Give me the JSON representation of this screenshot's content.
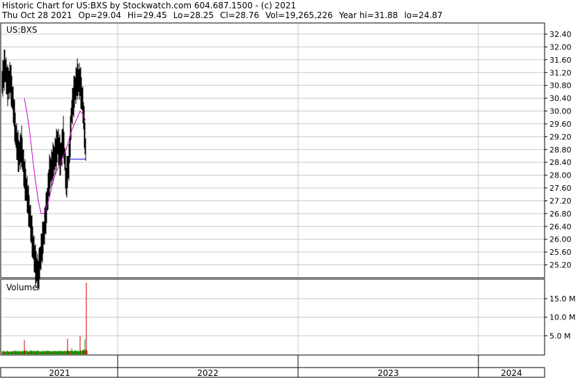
{
  "header": {
    "line1": "Historic Chart for US:BXS by Stockwatch.com 604.687.1500 - (c) 2021",
    "date": "Thu Oct 28 2021",
    "open": "Op=29.04",
    "high": "Hi=29.45",
    "low": "Lo=28.25",
    "close": "Cl=28.76",
    "volume": "Vol=19,265,226",
    "year_high": "Year hi=31.88",
    "year_low": "lo=24.87"
  },
  "colors": {
    "price": "#000000",
    "moving_average": "#cc00cc",
    "short_average": "#0000cc",
    "volume_up": "#00aa00",
    "volume_down": "#cc0000",
    "grid": "#c8c8c8"
  },
  "chart_data": [
    {
      "type": "line",
      "title": "US:BXS",
      "ylim": [
        24.8,
        32.8
      ],
      "yticks": [
        "32.40",
        "32.00",
        "31.60",
        "31.20",
        "30.80",
        "30.40",
        "30.00",
        "29.60",
        "29.20",
        "28.80",
        "28.40",
        "28.00",
        "27.60",
        "27.20",
        "26.80",
        "26.40",
        "26.00",
        "25.60",
        "25.20"
      ],
      "grid": true,
      "x_labels": [
        "2021",
        "2022",
        "2023",
        "2024"
      ],
      "x": [
        0,
        4,
        8,
        12,
        16,
        20,
        24,
        28,
        32,
        36,
        40,
        44,
        48,
        52,
        56,
        60,
        64,
        68,
        72,
        76,
        80,
        84,
        88,
        92,
        96,
        100,
        104,
        108,
        112,
        116,
        120
      ],
      "series": [
        {
          "style": "hl-bars",
          "values": [
            30.9,
            31.4,
            30.8,
            31.0,
            30.2,
            29.2,
            28.6,
            28.9,
            28.0,
            27.4,
            26.7,
            25.9,
            25.2,
            24.9,
            25.6,
            26.2,
            27.0,
            28.0,
            28.3,
            28.6,
            29.0,
            28.5,
            29.2,
            27.8,
            28.4,
            30.0,
            30.6,
            31.0,
            30.9,
            30.2,
            28.8
          ]
        },
        {
          "style": "line",
          "values": [
            null,
            null,
            null,
            null,
            null,
            null,
            null,
            null,
            30.4,
            29.9,
            29.3,
            28.5,
            27.8,
            27.2,
            26.8,
            26.8,
            27.0,
            27.3,
            27.7,
            28.0,
            28.2,
            28.4,
            28.6,
            28.8,
            29.1,
            29.4,
            29.6,
            29.8,
            30.0,
            29.9,
            29.7
          ]
        },
        {
          "style": "line",
          "values": [
            null,
            null,
            null,
            null,
            null,
            null,
            null,
            null,
            null,
            null,
            null,
            null,
            null,
            null,
            null,
            null,
            null,
            null,
            null,
            null,
            null,
            null,
            null,
            null,
            28.5,
            28.5,
            28.5,
            28.5,
            28.5,
            28.5,
            28.5
          ]
        }
      ]
    },
    {
      "type": "bar",
      "title": "Volume",
      "yticks": [
        "15.0 M",
        "10.0 M",
        "5.0 M"
      ],
      "ylim": [
        0,
        20
      ],
      "values": [
        0.9,
        0.8,
        0.7,
        1.0,
        0.8,
        0.6,
        0.7,
        1.0,
        0.9,
        0.8,
        0.7,
        0.6,
        0.9,
        0.8,
        0.8,
        0.7,
        1.0,
        0.9,
        0.8,
        0.9,
        1.1,
        0.8,
        0.7,
        0.9,
        1.0,
        0.8,
        0.8,
        0.9,
        0.7,
        1.0,
        0.8,
        0.9,
        3.8,
        1.0,
        0.8,
        1.2,
        0.9,
        0.7,
        0.8,
        0.9,
        0.8,
        1.2,
        0.9,
        1.0,
        0.8,
        0.9,
        1.0,
        0.8,
        0.9,
        0.8,
        1.1,
        0.9,
        1.0,
        0.8,
        0.9,
        0.8,
        0.7,
        0.9,
        1.0,
        0.8,
        0.7,
        0.9,
        1.0,
        0.8,
        0.9,
        1.1,
        0.8,
        0.9,
        1.0,
        0.8,
        0.9,
        0.7,
        0.8,
        1.0,
        0.9,
        0.8,
        0.9,
        1.0,
        0.8,
        0.9,
        0.8,
        1.0,
        0.9,
        0.8,
        0.9,
        1.0,
        0.8,
        0.9,
        0.8,
        0.9,
        1.0,
        0.8,
        0.9,
        1.0,
        4.2,
        1.0,
        0.9,
        0.8,
        0.9,
        1.0,
        1.6,
        0.9,
        1.0,
        0.8,
        0.9,
        1.2,
        1.0,
        0.9,
        0.8,
        1.0,
        0.9,
        0.8,
        5.0,
        1.1,
        0.9,
        1.0,
        1.1,
        1.4,
        1.0,
        4.0,
        1.3,
        19.3,
        1.0
      ],
      "down_days": [
        1,
        4,
        9,
        14,
        19,
        22,
        27,
        32,
        33,
        38,
        42,
        47,
        51,
        56,
        61,
        66,
        71,
        75,
        80,
        85,
        89,
        94,
        95,
        98,
        103,
        108,
        112,
        117,
        118,
        121,
        122
      ]
    }
  ]
}
